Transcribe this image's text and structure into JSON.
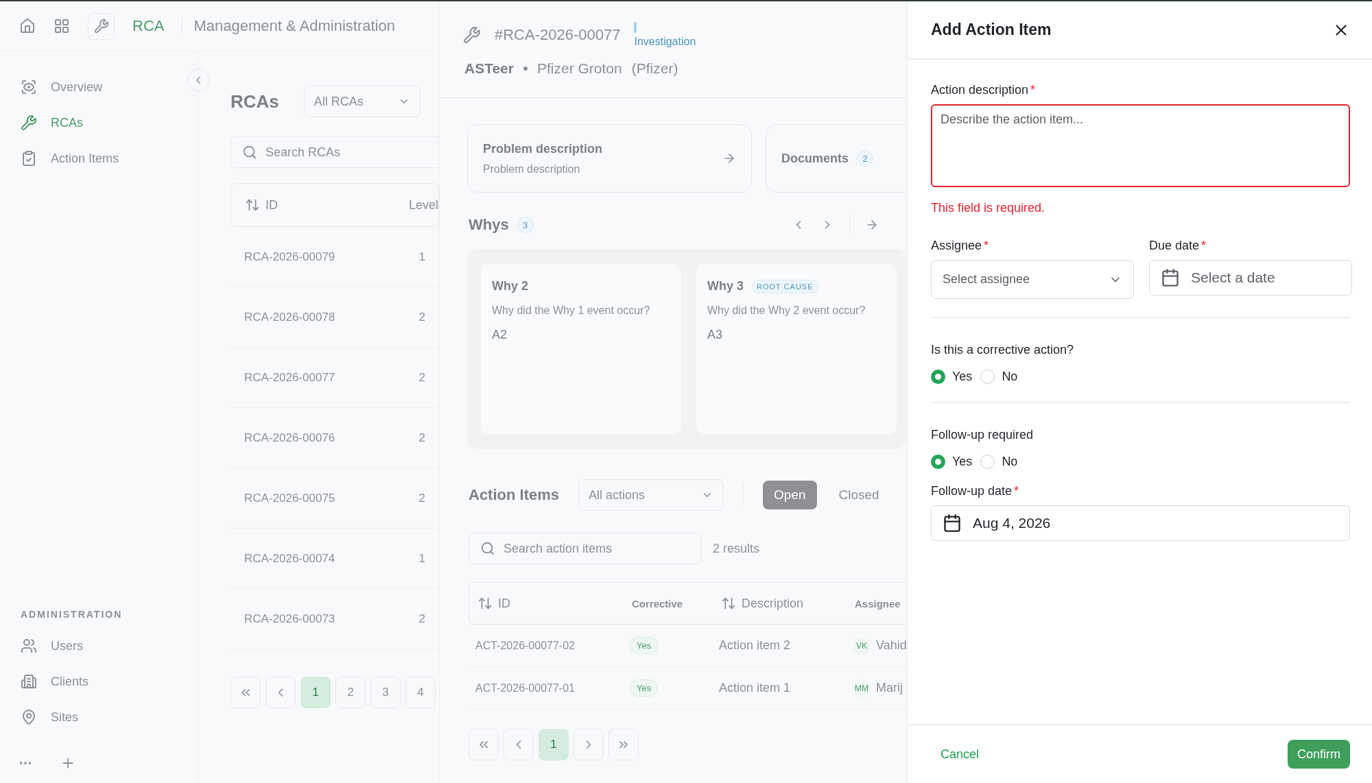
{
  "top_bar": {
    "app_name": "RCA",
    "section": "Management & Administration"
  },
  "sidebar": {
    "items": [
      {
        "label": "Overview",
        "selected": false
      },
      {
        "label": "RCAs",
        "selected": true
      },
      {
        "label": "Action Items",
        "selected": false
      }
    ],
    "admin_heading": "ADMINISTRATION",
    "admin_items": [
      {
        "label": "Users",
        "selected": false
      },
      {
        "label": "Clients",
        "selected": false
      },
      {
        "label": "Sites",
        "selected": false
      }
    ]
  },
  "rca_list": {
    "title": "RCAs",
    "filter": "All RCAs",
    "search_placeholder": "Search RCAs",
    "columns": [
      {
        "label": "ID",
        "sortable": true
      },
      {
        "label": "Level",
        "sortable": false
      }
    ],
    "rows": [
      {
        "id": "RCA-2026-00079",
        "level": "1"
      },
      {
        "id": "RCA-2026-00078",
        "level": "2"
      },
      {
        "id": "RCA-2026-00077",
        "level": "2"
      },
      {
        "id": "RCA-2026-00076",
        "level": "2"
      },
      {
        "id": "RCA-2026-00075",
        "level": "2"
      },
      {
        "id": "RCA-2026-00074",
        "level": "1"
      },
      {
        "id": "RCA-2026-00073",
        "level": "2"
      }
    ],
    "pages": [
      {
        "label": "1",
        "selected": true
      },
      {
        "label": "2",
        "selected": false
      },
      {
        "label": "3",
        "selected": false
      },
      {
        "label": "4",
        "selected": false
      }
    ]
  },
  "detail": {
    "number": "#RCA-2026-00077",
    "status": "Investigation",
    "name": "ASTeer",
    "site": "Pfizer Groton",
    "client": "(Pfizer)",
    "problem_card": {
      "title": "Problem description",
      "text": "Problem description"
    },
    "documents": {
      "label": "Documents",
      "count": "2"
    },
    "whys": {
      "title": "Whys",
      "count": "3",
      "cards": [
        {
          "title": "Why 2",
          "question": "Why did the Why 1 event occur?",
          "answer": "A2"
        },
        {
          "title": "Why 3",
          "badge": "ROOT CAUSE",
          "question": "Why did the Why 2 event occur?",
          "answer": "A3"
        }
      ]
    },
    "actions": {
      "title": "Action Items",
      "filter": "All actions",
      "tabs": [
        {
          "label": "Open",
          "selected": true
        },
        {
          "label": "Closed",
          "selected": false
        }
      ],
      "search_placeholder": "Search action items",
      "result_count": "2 results",
      "columns": [
        {
          "label": "ID",
          "sortable": true
        },
        {
          "label": "Corrective",
          "sortable": false
        },
        {
          "label": "Description",
          "sortable": true
        },
        {
          "label": "Assignee",
          "sortable": false
        }
      ],
      "rows": [
        {
          "id": "ACT-2026-00077-02",
          "corrective": "Yes",
          "description": "Action item 2",
          "initials": "VK",
          "assignee": "Vahid"
        },
        {
          "id": "ACT-2026-00077-01",
          "corrective": "Yes",
          "description": "Action item 1",
          "initials": "MM",
          "assignee": "Marij"
        }
      ],
      "pages": [
        {
          "label": "1",
          "selected": true
        }
      ]
    }
  },
  "drawer": {
    "title": "Add Action Item",
    "description": {
      "label": "Action description",
      "mark": "*",
      "placeholder": "Describe the action item...",
      "invalid": true,
      "error": "This field is required."
    },
    "assignee": {
      "label": "Assignee",
      "mark": "*",
      "placeholder": "Select assignee"
    },
    "due_date": {
      "label": "Due date",
      "mark": "*",
      "placeholder": "Select a date"
    },
    "corrective": {
      "label": "Is this a corrective action?",
      "options": [
        {
          "label": "Yes",
          "selected": true
        },
        {
          "label": "No",
          "selected": false
        }
      ]
    },
    "follow_up": {
      "label": "Follow-up required",
      "options": [
        {
          "label": "Yes",
          "selected": true
        },
        {
          "label": "No",
          "selected": false
        }
      ]
    },
    "follow_up_date": {
      "label": "Follow-up date",
      "mark": "*",
      "value": "Aug 4, 2026"
    },
    "buttons": {
      "cancel": "Cancel",
      "confirm": "Confirm"
    }
  }
}
